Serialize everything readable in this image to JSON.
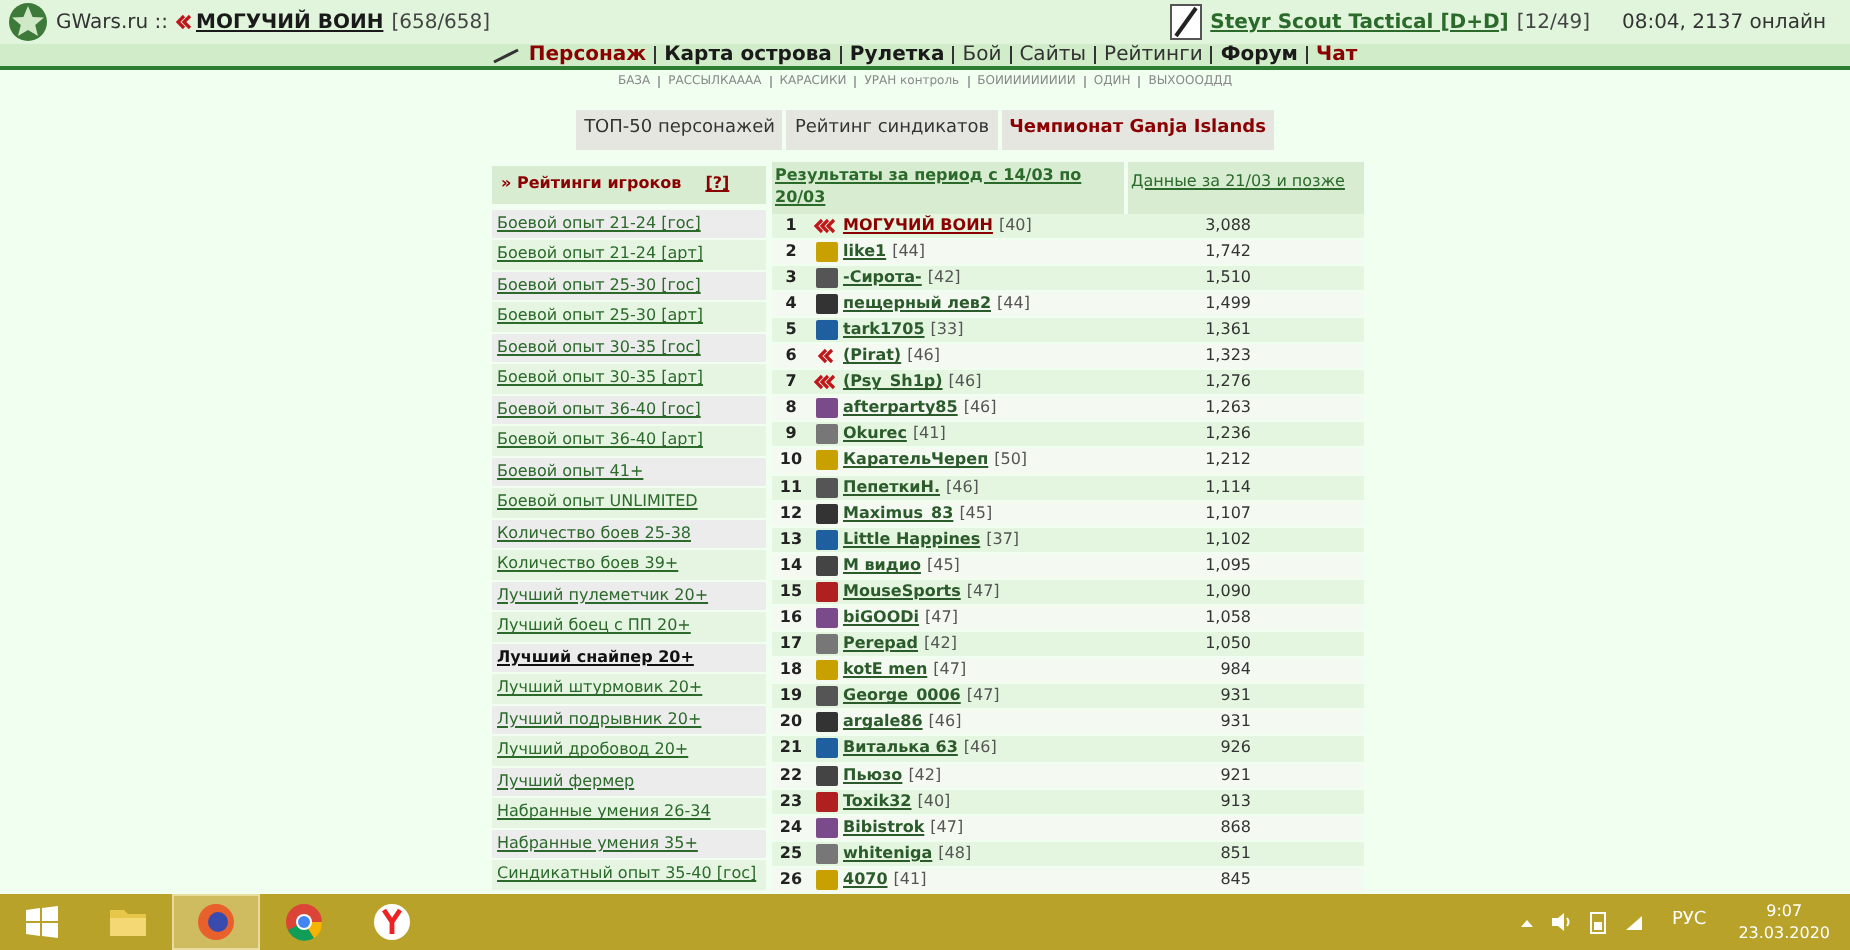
{
  "header": {
    "site": "GWars.ru ::",
    "player": "МОГУЧИЙ ВОИН",
    "hp": "[658/658]",
    "weapon": "Steyr Scout Tactical [D+D]",
    "ammo": "[12/49]",
    "status": "08:04, 2137 онлайн"
  },
  "nav": [
    {
      "label": "Персонаж",
      "kind": "red"
    },
    {
      "label": "Карта острова",
      "kind": "bold"
    },
    {
      "label": "Рулетка",
      "kind": "bold"
    },
    {
      "label": "Бой",
      "kind": "normal"
    },
    {
      "label": "Сайты",
      "kind": "normal"
    },
    {
      "label": "Рейтинги",
      "kind": "normal"
    },
    {
      "label": "Форум",
      "kind": "bold"
    },
    {
      "label": "Чат",
      "kind": "red"
    }
  ],
  "sublinks": [
    "БАЗА",
    "РАССЫЛКАААА",
    "КАРАСИКИ",
    "УРАН контроль",
    "БОИИИИИИИИИ",
    "ОДИН",
    "ВЫХОООДДД"
  ],
  "tabs": [
    {
      "label": "ТОП-50 персонажей",
      "selected": false
    },
    {
      "label": "Рейтинг синдикатов",
      "selected": false
    },
    {
      "label": "Чемпионат Ganja Islands",
      "selected": true
    }
  ],
  "sidebar": {
    "title": "» Рейтинги игроков",
    "help": "[?]",
    "items": [
      {
        "label": "Боевой опыт 21-24 [гос]",
        "selected": false
      },
      {
        "label": "Боевой опыт 21-24 [арт]",
        "selected": false
      },
      {
        "label": "Боевой опыт 25-30 [гос]",
        "selected": false
      },
      {
        "label": "Боевой опыт 25-30 [арт]",
        "selected": false
      },
      {
        "label": "Боевой опыт 30-35 [гос]",
        "selected": false
      },
      {
        "label": "Боевой опыт 30-35 [арт]",
        "selected": false
      },
      {
        "label": "Боевой опыт 36-40 [гос]",
        "selected": false
      },
      {
        "label": "Боевой опыт 36-40 [арт]",
        "selected": false
      },
      {
        "label": "Боевой опыт 41+",
        "selected": false
      },
      {
        "label": "Боевой опыт UNLIMITED",
        "selected": false
      },
      {
        "label": "Количество боев 25-38",
        "selected": false
      },
      {
        "label": "Количество боев 39+",
        "selected": false
      },
      {
        "label": "Лучший пулеметчик 20+",
        "selected": false
      },
      {
        "label": "Лучший боец с ПП 20+",
        "selected": false
      },
      {
        "label": "Лучший снайпер 20+",
        "selected": true
      },
      {
        "label": "Лучший штурмовик 20+",
        "selected": false
      },
      {
        "label": "Лучший подрывник 20+",
        "selected": false
      },
      {
        "label": "Лучший дробовод 20+",
        "selected": false
      },
      {
        "label": "Лучший фермер",
        "selected": false
      },
      {
        "label": "Набранные умения 26-34",
        "selected": false
      },
      {
        "label": "Набранные умения 35+",
        "selected": false
      },
      {
        "label": "Синдикатный опыт 35-40 [гос]",
        "selected": false
      }
    ]
  },
  "table": {
    "columns": [
      "Результаты за период с 14/03 по 20/03",
      "Данные за 21/03 и позже"
    ],
    "rows": [
      {
        "rank": "1",
        "kind": "triple",
        "name": "МОГУЧИЙ ВОИН",
        "level": "[40]",
        "score": "3,088",
        "highlighted": true
      },
      {
        "rank": "2",
        "kind": "emblem",
        "name": "like1",
        "level": "[44]",
        "score": "1,742",
        "highlighted": false
      },
      {
        "rank": "3",
        "kind": "emblem",
        "name": "-Сирота-",
        "level": "[42]",
        "score": "1,510",
        "highlighted": false
      },
      {
        "rank": "4",
        "kind": "emblem",
        "name": "пещерный лев2",
        "level": "[44]",
        "score": "1,499",
        "highlighted": false
      },
      {
        "rank": "5",
        "kind": "emblem",
        "name": "tark1705",
        "level": "[33]",
        "score": "1,361",
        "highlighted": false
      },
      {
        "rank": "6",
        "kind": "double",
        "name": "(Pirat)",
        "level": "[46]",
        "score": "1,323",
        "highlighted": false
      },
      {
        "rank": "7",
        "kind": "triple",
        "name": "(Psy_Sh1p)",
        "level": "[46]",
        "score": "1,276",
        "highlighted": false
      },
      {
        "rank": "8",
        "kind": "emblem",
        "name": "afterparty85",
        "level": "[46]",
        "score": "1,263",
        "highlighted": false
      },
      {
        "rank": "9",
        "kind": "emblem",
        "name": "Okurec",
        "level": "[41]",
        "score": "1,236",
        "highlighted": false
      },
      {
        "rank": "10",
        "kind": "emblem",
        "name": "КарательЧереп",
        "level": "[50]",
        "score": "1,212",
        "highlighted": false
      },
      {
        "rank": "11",
        "kind": "emblem",
        "name": "ПепеткиН.",
        "level": "[46]",
        "score": "1,114",
        "highlighted": false
      },
      {
        "rank": "12",
        "kind": "emblem",
        "name": "Maximus_83",
        "level": "[45]",
        "score": "1,107",
        "highlighted": false
      },
      {
        "rank": "13",
        "kind": "emblem",
        "name": "Little Happines",
        "level": "[37]",
        "score": "1,102",
        "highlighted": false
      },
      {
        "rank": "14",
        "kind": "emblem",
        "name": "М видио",
        "level": "[45]",
        "score": "1,095",
        "highlighted": false
      },
      {
        "rank": "15",
        "kind": "emblem",
        "name": "MouseSports",
        "level": "[47]",
        "score": "1,090",
        "highlighted": false
      },
      {
        "rank": "16",
        "kind": "emblem",
        "name": "biGOODi",
        "level": "[47]",
        "score": "1,058",
        "highlighted": false
      },
      {
        "rank": "17",
        "kind": "emblem",
        "name": "Perepad",
        "level": "[42]",
        "score": "1,050",
        "highlighted": false
      },
      {
        "rank": "18",
        "kind": "emblem",
        "name": "kotE men",
        "level": "[47]",
        "score": "984",
        "highlighted": false
      },
      {
        "rank": "19",
        "kind": "emblem",
        "name": "George_0006",
        "level": "[47]",
        "score": "931",
        "highlighted": false
      },
      {
        "rank": "20",
        "kind": "emblem",
        "name": "argale86",
        "level": "[46]",
        "score": "931",
        "highlighted": false
      },
      {
        "rank": "21",
        "kind": "emblem",
        "name": "Виталька 63",
        "level": "[46]",
        "score": "926",
        "highlighted": false
      },
      {
        "rank": "22",
        "kind": "emblem",
        "name": "Пьюзо",
        "level": "[42]",
        "score": "921",
        "highlighted": false
      },
      {
        "rank": "23",
        "kind": "emblem",
        "name": "Toxik32",
        "level": "[40]",
        "score": "913",
        "highlighted": false
      },
      {
        "rank": "24",
        "kind": "emblem",
        "name": "Bibistrok",
        "level": "[47]",
        "score": "868",
        "highlighted": false
      },
      {
        "rank": "25",
        "kind": "emblem",
        "name": "whiteniga",
        "level": "[48]",
        "score": "851",
        "highlighted": false
      },
      {
        "rank": "26",
        "kind": "emblem",
        "name": "4070",
        "level": "[41]",
        "score": "845",
        "highlighted": false
      }
    ]
  },
  "taskbar": {
    "apps": [
      {
        "kind": "folder",
        "selected": false
      },
      {
        "kind": "firefox",
        "selected": true
      },
      {
        "kind": "chrome",
        "selected": false
      },
      {
        "kind": "yandex",
        "selected": false
      }
    ],
    "language": "РУС",
    "time": "9:07",
    "date": "23.03.2020"
  }
}
